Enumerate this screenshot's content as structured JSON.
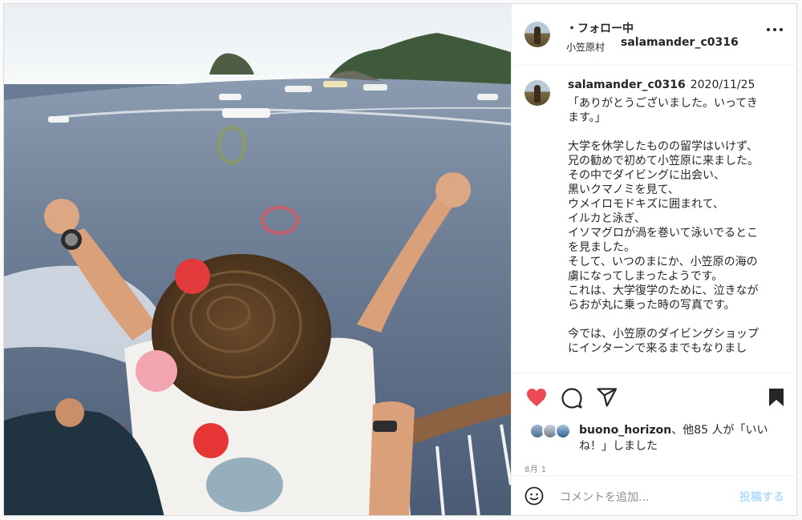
{
  "colors": {
    "heart": "#ed4956",
    "text": "#262626",
    "secondary": "#8e8e8e",
    "post_button": "#b2dffc",
    "border": "#dbdbdb"
  },
  "photo": {
    "alt_icon": "photo"
  },
  "header": {
    "username": "salamander_c0316",
    "separator": "・",
    "follow_status": "フォロー中",
    "location": "小笠原村",
    "more_icon": "more-horizontal-icon"
  },
  "caption": {
    "username": "salamander_c0316",
    "date": "2020/11/25",
    "lines": [
      "「ありがとうございました。いってき",
      "ます。」",
      "",
      "大学を休学したものの留学はいけず、",
      "兄の勧めで初めて小笠原に来ました。",
      "その中でダイビングに出会い、",
      "黒いクマノミを見て、",
      "ウメイロモドキズに囲まれて、",
      "イルカと泳ぎ、",
      "イソマグロが渦を巻いて泳いでるとこ",
      "を見ました。",
      "そして、いつのまにか、小笠原の海の",
      "虜になってしまったようです。",
      "これは、大学復学のために、泣きなが",
      "らおが丸に乗った時の写真です。",
      "",
      "今では、小笠原のダイビングショップ",
      "にインターンで来るまでもなりまし"
    ]
  },
  "actions": {
    "like_icon": "heart-filled-icon",
    "comment_icon": "comment-icon",
    "share_icon": "paper-plane-icon",
    "save_icon": "bookmark-filled-icon"
  },
  "likes": {
    "user": "buono_horizon",
    "rest": "、他85 人が「いいね！」しました"
  },
  "timestamp": "8月 1",
  "comment_box": {
    "emoji_icon": "smiley-icon",
    "placeholder": "コメントを追加...",
    "post_label": "投稿する"
  }
}
